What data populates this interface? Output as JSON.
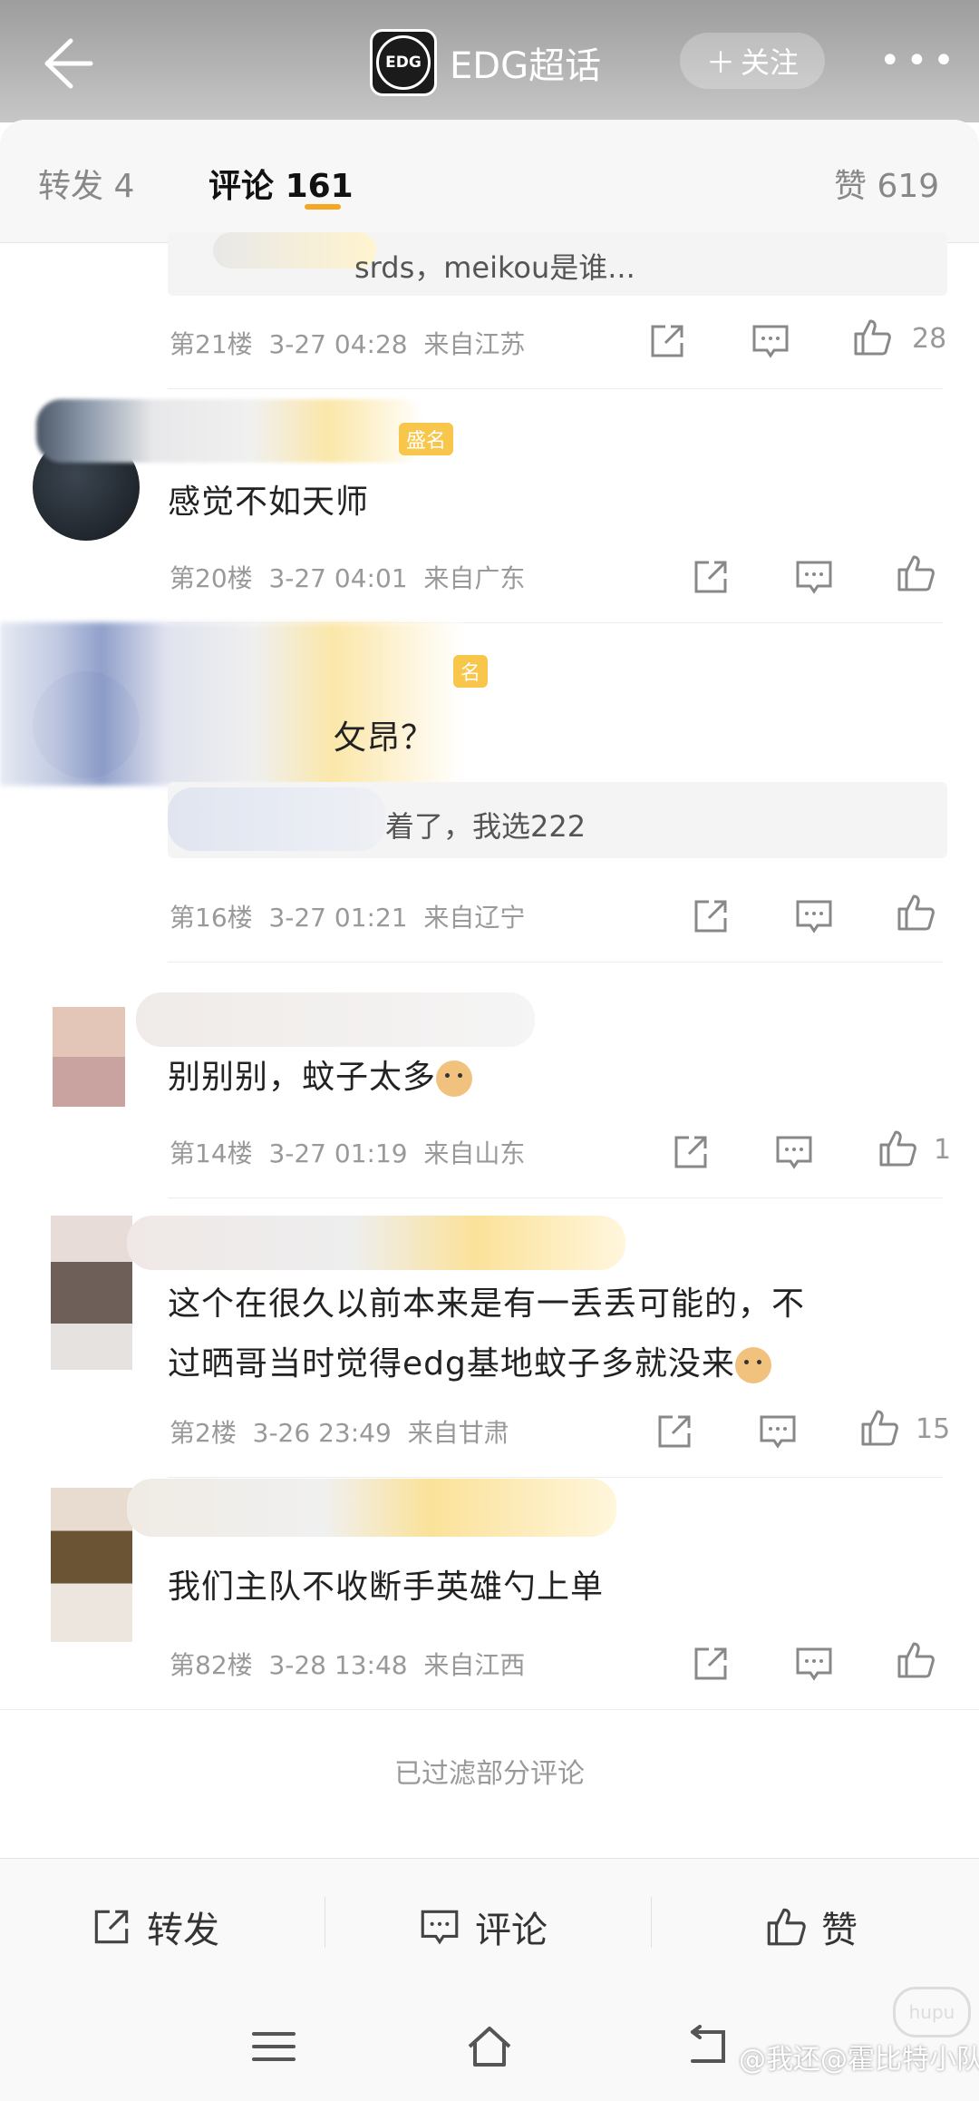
{
  "header": {
    "title": "EDG超话",
    "logo_text": "EDG",
    "follow_label": "关注",
    "more_label": "•••"
  },
  "tabs": {
    "repost_label": "转发",
    "repost_count": "4",
    "comment_label": "评论",
    "comment_count": "161",
    "like_label": "赞",
    "like_count": "619"
  },
  "comments": [
    {
      "quote": "srds，meikou是谁...",
      "floor": "第21楼",
      "time": "3-27 04:28",
      "location": "来自江苏",
      "likes": "28"
    },
    {
      "badge": "盛名",
      "text": "感觉不如天师",
      "floor": "第20楼",
      "time": "3-27 04:01",
      "location": "来自广东",
      "likes": ""
    },
    {
      "badge": "名",
      "text": "攵昂？",
      "quote": "着了，我选222",
      "floor": "第16楼",
      "time": "3-27 01:21",
      "location": "来自辽宁",
      "likes": ""
    },
    {
      "text": "别别别，蚊子太多",
      "floor": "第14楼",
      "time": "3-27 01:19",
      "location": "来自山东",
      "likes": "1"
    },
    {
      "text_line1": "这个在很久以前本来是有一丢丢可能的，不",
      "text_line2": "过晒哥当时觉得edg基地蚊子多就没来",
      "floor": "第2楼",
      "time": "3-26 23:49",
      "location": "来自甘肃",
      "likes": "15"
    },
    {
      "text": "我们主队不收断手英雄勺上单",
      "floor": "第82楼",
      "time": "3-28 13:48",
      "location": "来自江西",
      "likes": ""
    }
  ],
  "filtered_note": "已过滤部分评论",
  "bottom_actions": {
    "repost": "转发",
    "comment": "评论",
    "like": "赞"
  },
  "watermark": "@我还@霍比特小队儿",
  "watermark_logo": "hupu",
  "colors": {
    "accent": "#f5a623",
    "badge": "#f7c64b"
  }
}
